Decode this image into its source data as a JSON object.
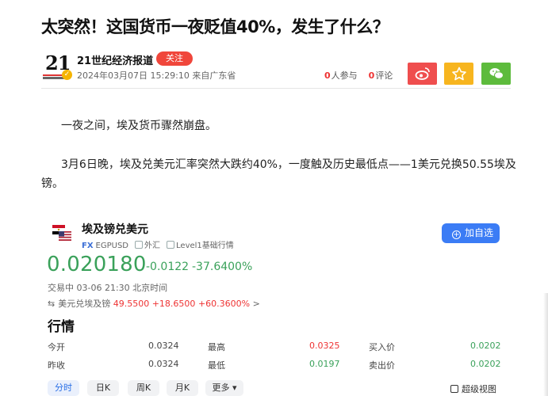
{
  "article": {
    "title": "太突然！这国货币一夜贬值40%，发生了什么？",
    "source": {
      "logo_text": "21",
      "name": "21世纪经济报道",
      "follow_label": "关注",
      "meta": "2024年03月07日 15:29:10 来自广东省"
    },
    "stats": {
      "participants_num": "0",
      "participants_label": "人参与",
      "comments_num": "0",
      "comments_label": "评论"
    },
    "share": {
      "weibo_icon": "weibo-icon",
      "favorite_icon": "star-icon",
      "wechat_icon": "wechat-icon",
      "colors": {
        "weibo": "#ef4e4e",
        "favorite": "#f7b51f",
        "wechat": "#5dbb3c"
      }
    },
    "paragraphs": [
      "一夜之间，埃及货币骤然崩盘。",
      "3月6日晚，埃及兑美元汇率突然大跌约40%，一度触及历史最低点——1美元兑换50.55埃及镑。"
    ]
  },
  "quote_card": {
    "name": "埃及镑兑美元",
    "tag_market": "FX",
    "symbol": "EGPUSD",
    "tag_type": "外汇",
    "tag_level": "Level1基础行情",
    "add_button": "加自选",
    "price": "0.020180",
    "change": "-0.0122",
    "change_pct": "-37.6400%",
    "status": "交易中 03-06 21:30 北京时间",
    "cross": {
      "label": "美元兑埃及镑",
      "value": "49.5500",
      "change": "+18.6500",
      "change_pct": "+60.3600%",
      "chevron": ">"
    },
    "section_title": "行情",
    "quotes": [
      {
        "label1": "今开",
        "value1": "0.0324",
        "label2": "最高",
        "value2": "0.0325",
        "label3": "买入价",
        "value3": "0.0202"
      },
      {
        "label1": "昨收",
        "value1": "0.0324",
        "label2": "最低",
        "value2": "0.0197",
        "label3": "卖出价",
        "value3": "0.0202"
      }
    ],
    "tabs": [
      "分时",
      "日K",
      "周K",
      "月K",
      "更多"
    ],
    "active_tab": "分时",
    "super_view": "超级视图",
    "colors": {
      "down": "#3aa15a",
      "up": "#e33333",
      "accent": "#3b7cf5"
    }
  }
}
